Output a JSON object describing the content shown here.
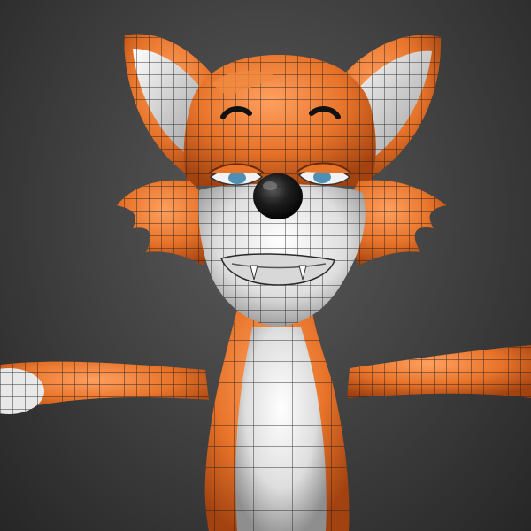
{
  "scene": {
    "subject": "cartoon-fox-wireframe-model",
    "background_color": "#3a3a3a",
    "colors": {
      "fur_orange": "#e8742a",
      "fur_orange_dark": "#b24a10",
      "fur_white": "#eeeeee",
      "fur_white_shade": "#a9a9a9",
      "nose": "#141414",
      "eye_iris": "#4f8fb4",
      "wire": "#1a1a1a"
    }
  }
}
